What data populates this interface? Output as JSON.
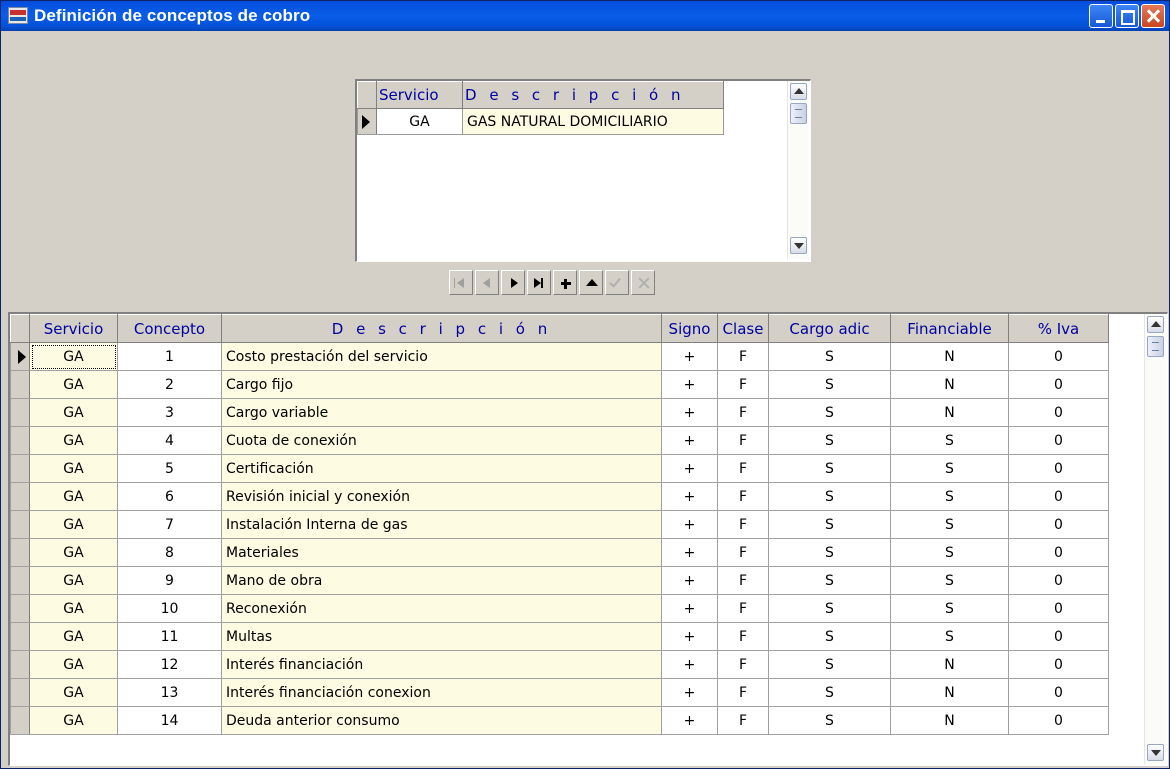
{
  "window": {
    "title": "Definición de conceptos de cobro",
    "icon": "app-logo-icon"
  },
  "services_grid": {
    "columns": [
      "Servicio",
      "D e s c r i p c i ó n"
    ],
    "rows": [
      {
        "servicio": "GA",
        "descripcion": "GAS NATURAL DOMICILIARIO"
      }
    ]
  },
  "navigator": {
    "buttons": [
      "first",
      "prior",
      "next",
      "last",
      "insert",
      "delete",
      "post",
      "cancel"
    ]
  },
  "concepts_grid": {
    "columns": [
      "Servicio",
      "Concepto",
      "D e s c r i p c i ó n",
      "Signo",
      "Clase",
      "Cargo adic",
      "Financiable",
      "% Iva"
    ],
    "rows": [
      {
        "servicio": "GA",
        "concepto": "1",
        "descripcion": "Costo prestación del servicio",
        "signo": "+",
        "clase": "F",
        "cargo": "S",
        "financiable": "N",
        "iva": "0"
      },
      {
        "servicio": "GA",
        "concepto": "2",
        "descripcion": "Cargo fijo",
        "signo": "+",
        "clase": "F",
        "cargo": "S",
        "financiable": "N",
        "iva": "0"
      },
      {
        "servicio": "GA",
        "concepto": "3",
        "descripcion": "Cargo variable",
        "signo": "+",
        "clase": "F",
        "cargo": "S",
        "financiable": "N",
        "iva": "0"
      },
      {
        "servicio": "GA",
        "concepto": "4",
        "descripcion": "Cuota de conexión",
        "signo": "+",
        "clase": "F",
        "cargo": "S",
        "financiable": "S",
        "iva": "0"
      },
      {
        "servicio": "GA",
        "concepto": "5",
        "descripcion": "Certificación",
        "signo": "+",
        "clase": "F",
        "cargo": "S",
        "financiable": "S",
        "iva": "0"
      },
      {
        "servicio": "GA",
        "concepto": "6",
        "descripcion": "Revisión inicial y conexión",
        "signo": "+",
        "clase": "F",
        "cargo": "S",
        "financiable": "S",
        "iva": "0"
      },
      {
        "servicio": "GA",
        "concepto": "7",
        "descripcion": "Instalación Interna de gas",
        "signo": "+",
        "clase": "F",
        "cargo": "S",
        "financiable": "S",
        "iva": "0"
      },
      {
        "servicio": "GA",
        "concepto": "8",
        "descripcion": "Materiales",
        "signo": "+",
        "clase": "F",
        "cargo": "S",
        "financiable": "S",
        "iva": "0"
      },
      {
        "servicio": "GA",
        "concepto": "9",
        "descripcion": "Mano de obra",
        "signo": "+",
        "clase": "F",
        "cargo": "S",
        "financiable": "S",
        "iva": "0"
      },
      {
        "servicio": "GA",
        "concepto": "10",
        "descripcion": "Reconexión",
        "signo": "+",
        "clase": "F",
        "cargo": "S",
        "financiable": "S",
        "iva": "0"
      },
      {
        "servicio": "GA",
        "concepto": "11",
        "descripcion": "Multas",
        "signo": "+",
        "clase": "F",
        "cargo": "S",
        "financiable": "S",
        "iva": "0"
      },
      {
        "servicio": "GA",
        "concepto": "12",
        "descripcion": "Interés financiación",
        "signo": "+",
        "clase": "F",
        "cargo": "S",
        "financiable": "N",
        "iva": "0"
      },
      {
        "servicio": "GA",
        "concepto": "13",
        "descripcion": "Interés financiación conexion",
        "signo": "+",
        "clase": "F",
        "cargo": "S",
        "financiable": "N",
        "iva": "0"
      },
      {
        "servicio": "GA",
        "concepto": "14",
        "descripcion": "Deuda anterior consumo",
        "signo": "+",
        "clase": "F",
        "cargo": "S",
        "financiable": "N",
        "iva": "0"
      }
    ]
  },
  "colors": {
    "title_bar": "#0553e0",
    "face": "#d4d0c8",
    "header_text": "#0000a0",
    "cell_highlight": "#fdfbe1"
  }
}
